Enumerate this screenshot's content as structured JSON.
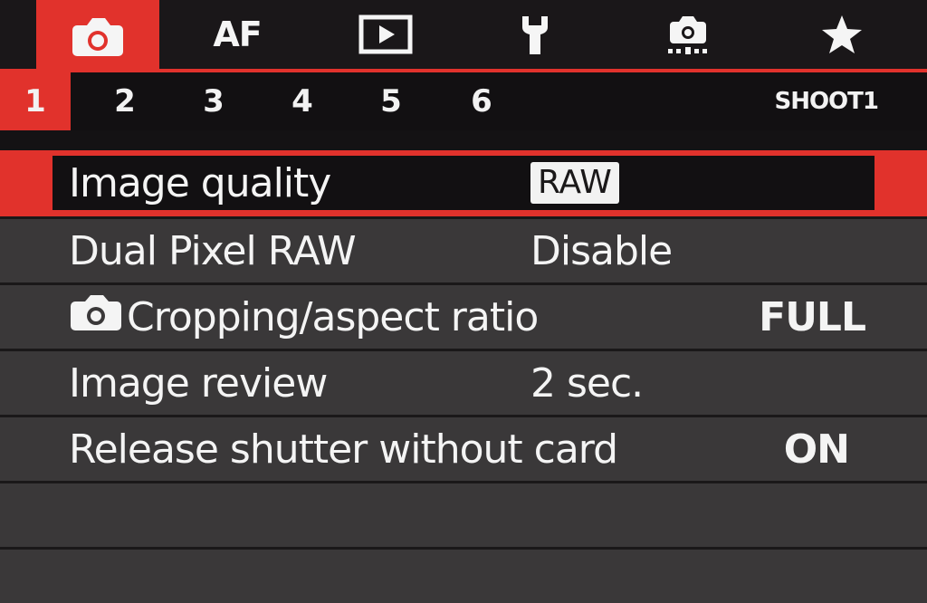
{
  "header": {
    "tabs": [
      {
        "name": "shooting",
        "icon": "camera-icon",
        "active": true
      },
      {
        "name": "af",
        "label": "AF",
        "active": false
      },
      {
        "name": "playback",
        "icon": "play-icon",
        "active": false
      },
      {
        "name": "setup",
        "icon": "wrench-icon",
        "active": false
      },
      {
        "name": "custom-functions",
        "icon": "camera-custom-icon",
        "active": false
      },
      {
        "name": "my-menu",
        "icon": "star-icon",
        "active": false
      }
    ]
  },
  "pages": {
    "numbers": [
      "1",
      "2",
      "3",
      "4",
      "5",
      "6"
    ],
    "active_index": 0,
    "label": "SHOOT1"
  },
  "menu": {
    "items": [
      {
        "label": "Image quality",
        "value": "RAW",
        "selected": true
      },
      {
        "label": "Dual Pixel RAW",
        "value": "Disable",
        "selected": false
      },
      {
        "label": "Cropping/aspect ratio",
        "value": "FULL",
        "icon": "camera-icon",
        "selected": false
      },
      {
        "label": "Image review",
        "value": "2 sec.",
        "selected": false
      },
      {
        "label": "Release shutter without card",
        "value": "ON",
        "selected": false
      }
    ]
  },
  "colors": {
    "accent": "#e1322c",
    "row_bg": "#3a3839",
    "text": "#f4f4f4"
  }
}
